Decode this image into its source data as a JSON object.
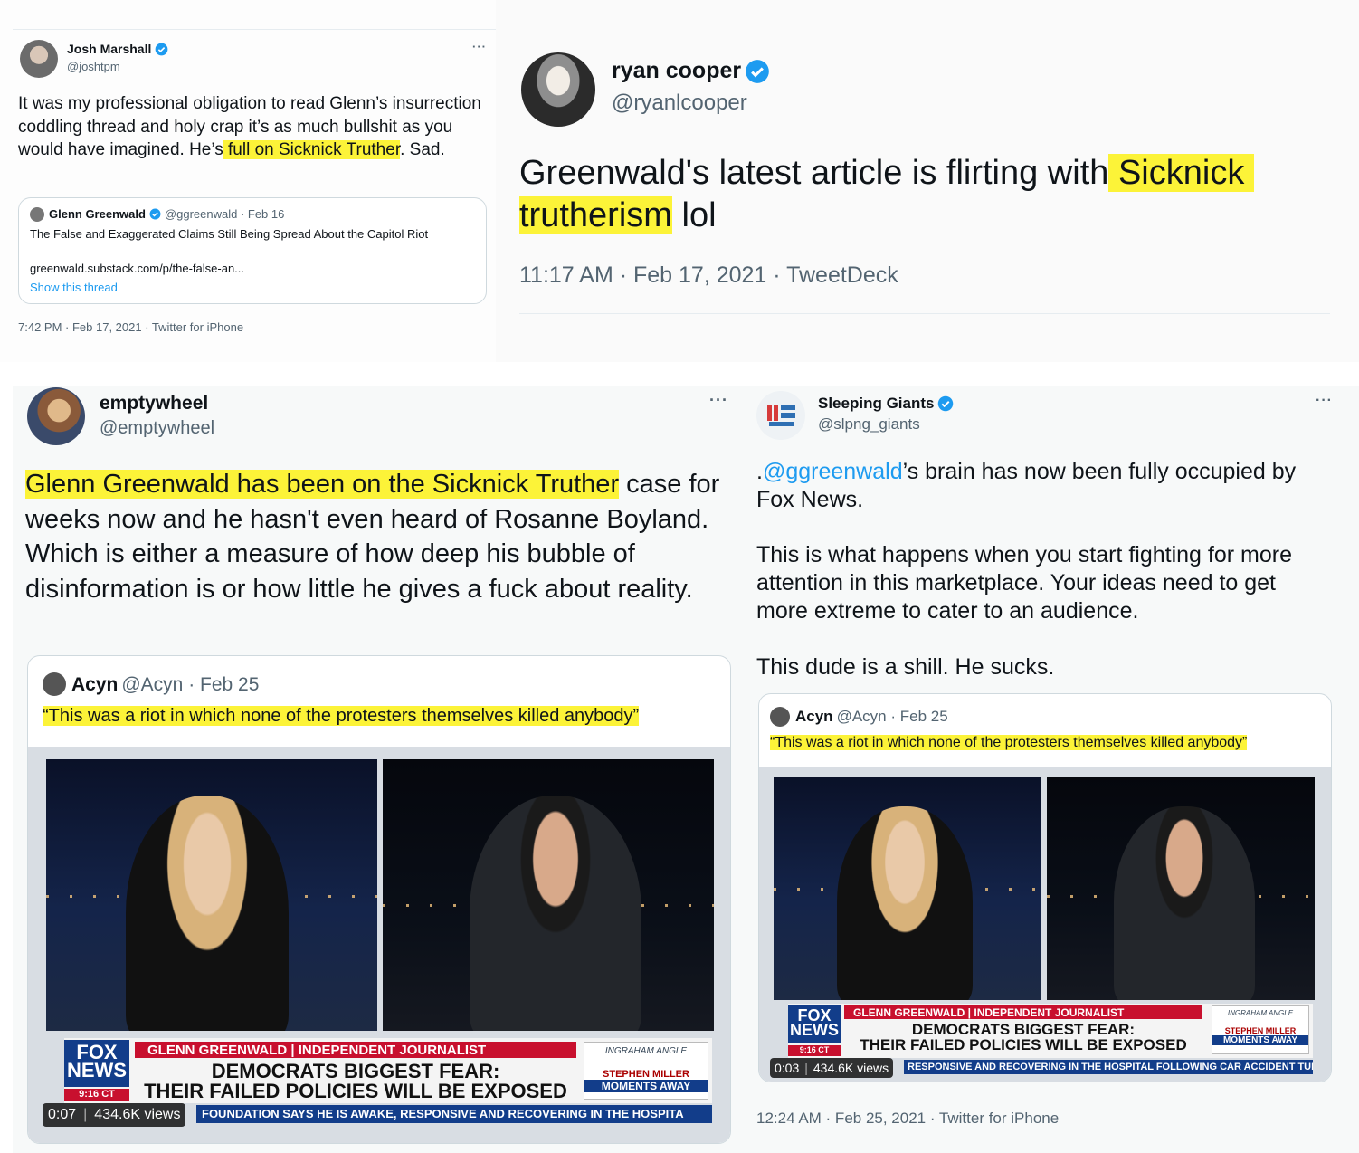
{
  "tweet1": {
    "name": "Josh Marshall",
    "handle": "@joshtpm",
    "more": "···",
    "text_part1": "It was my professional obligation to read Glenn’s insurrection coddling thread and holy crap it’s as much bullshit as you would have imagined. He’s",
    "text_hl": " full on Sicknick Truther",
    "text_part2": ". Sad.",
    "quote": {
      "name": "Glenn Greenwald",
      "handle_date": "@ggreenwald · Feb 16",
      "title": "The False and Exaggerated Claims Still Being Spread About the Capitol Riot",
      "url": "greenwald.substack.com/p/the-false-an...",
      "show_thread": "Show this thread"
    },
    "meta": "7:42 PM · Feb 17, 2021 · Twitter for iPhone"
  },
  "tweet2": {
    "name": "ryan cooper",
    "handle": "@ryanlcooper",
    "text_part1": "Greenwald's latest article is flirting with",
    "text_hl": " Sicknick truthe",
    "text_hl2": "rism",
    "text_part2": " lol",
    "meta": "11:17 AM · Feb 17, 2021 · TweetDeck"
  },
  "tweet3": {
    "name": "emptywheel",
    "handle": "@emptywheel",
    "more": "···",
    "text_hl": "Glenn Greenwald has been on the Sicknick Truther",
    "text_rest": " case for weeks now and he hasn't even heard of Rosanne Boyland. Which is either a measure of how deep his bubble of disinformation is or how little he gives a fuck about reality.",
    "quote": {
      "name": "Acyn",
      "handle_date": "@Acyn · Feb 25",
      "quote_text": "“This was a riot in which none of the protesters themselves killed anybody”"
    },
    "video": {
      "chyron_top": "GLENN GREENWALD | INDEPENDENT JOURNALIST",
      "chyron_line1": "DEMOCRATS BIGGEST FEAR:",
      "chyron_line2": "THEIR FAILED POLICIES WILL BE EXPOSED",
      "fox_line1": "FOX",
      "fox_line2": "NEWS",
      "fox_time": "9:16 CT",
      "ingraham": "INGRAHAM ANGLE",
      "promo_line1": "STEPHEN MILLER",
      "promo_line2": "MOMENTS AWAY",
      "ticker": "FOUNDATION SAYS HE IS AWAKE, RESPONSIVE AND RECOVERING IN THE HOSPITA",
      "time": "0:07",
      "views": "434.6K views"
    }
  },
  "tweet4": {
    "name": "Sleeping Giants",
    "handle": "@slpng_giants",
    "more": "···",
    "text_prefix": ".",
    "mention": "@ggreenwald",
    "text_line1_rest": "’s brain has now been fully occupied by Fox News.",
    "text_para2": "This is what happens when you start fighting for more attention in this marketplace. Your ideas need to get more extreme to cater to an audience.",
    "text_para3": "This dude is a shill. He sucks.",
    "quote": {
      "name": "Acyn",
      "handle_date": "@Acyn · Feb 25",
      "quote_text": "“This was a riot in which none of the protesters themselves killed anybody”"
    },
    "video": {
      "chyron_top": "GLENN GREENWALD | INDEPENDENT JOURNALIST",
      "chyron_line1": "DEMOCRATS BIGGEST FEAR:",
      "chyron_line2": "THEIR FAILED POLICIES WILL BE EXPOSED",
      "fox_line1": "FOX",
      "fox_line2": "NEWS",
      "fox_time": "9:16 CT",
      "ingraham": "INGRAHAM ANGLE",
      "promo_line1": "STEPHEN MILLER",
      "promo_line2": "MOMENTS AWAY",
      "ticker": "RESPONSIVE AND RECOVERING IN THE HOSPITAL FOLLOWING CAR ACCIDENT TUES",
      "time": "0:03",
      "views": "434.6K views"
    },
    "meta": "12:24 AM · Feb 25, 2021 · Twitter for iPhone"
  },
  "colors": {
    "highlight": "#fcf338",
    "link": "#1d9bf0",
    "verified": "#1d9bf0",
    "secondary": "#536471"
  }
}
